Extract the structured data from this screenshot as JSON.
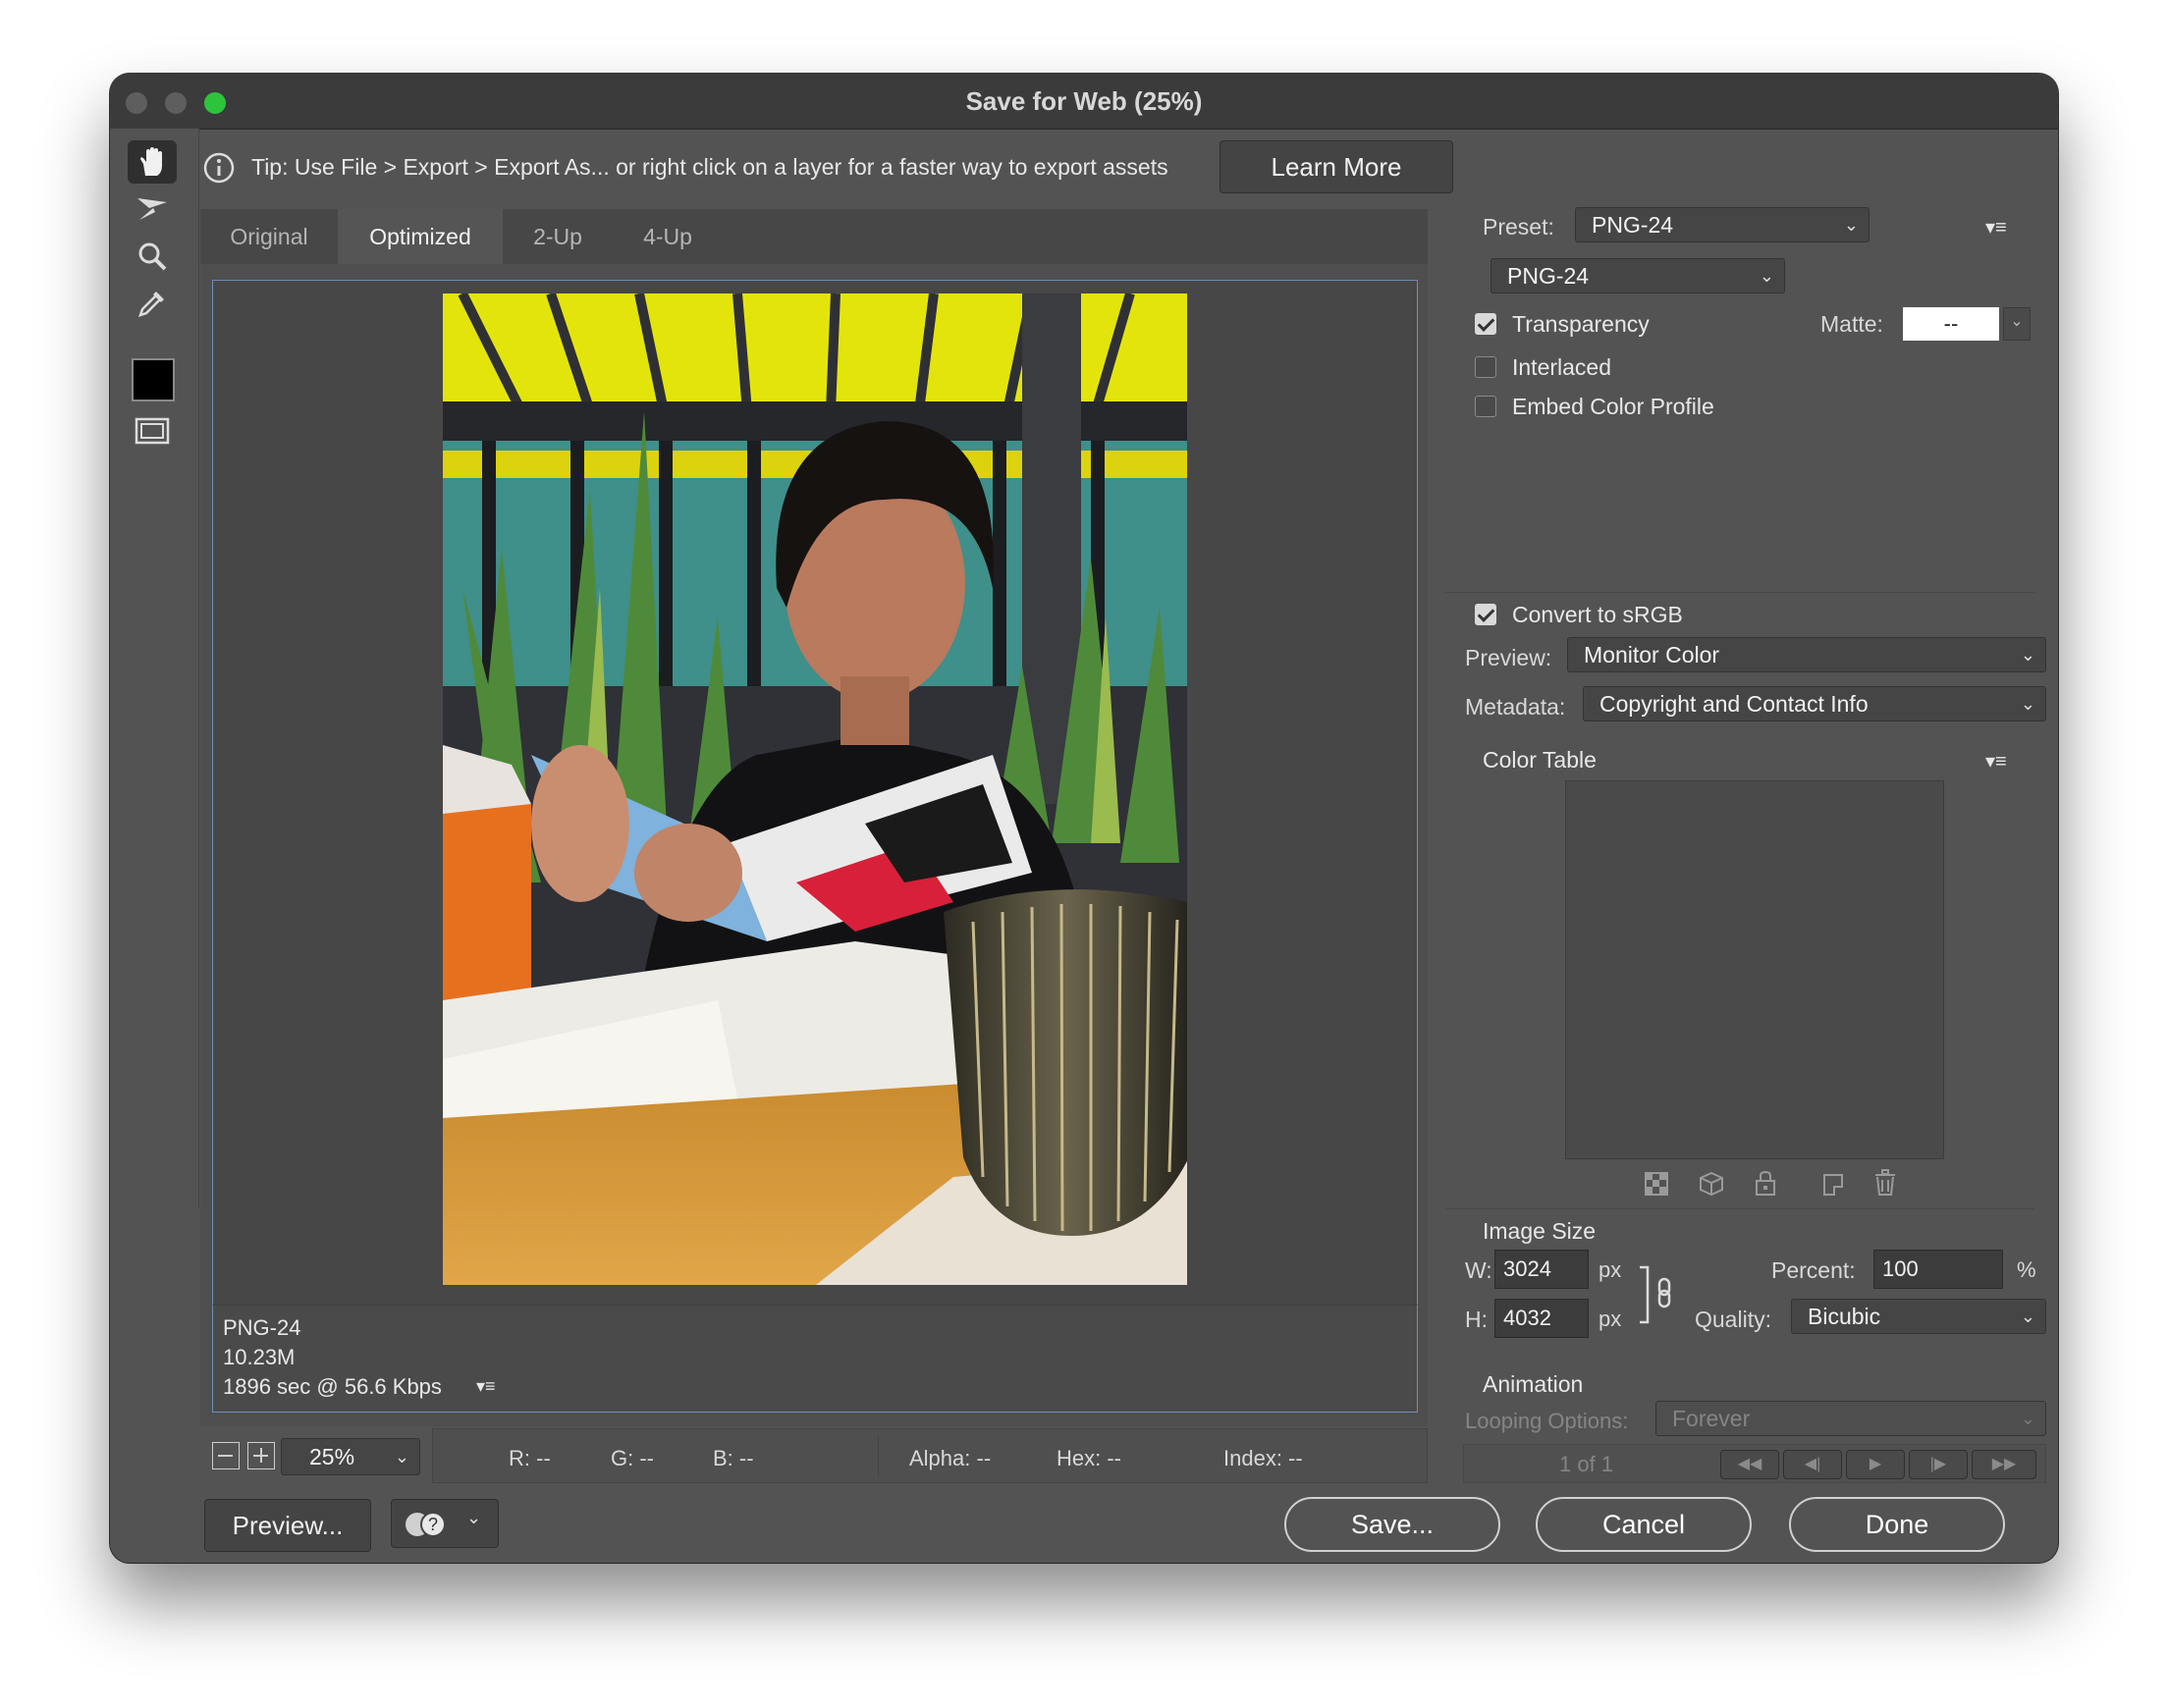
{
  "window": {
    "title": "Save for Web (25%)"
  },
  "tip": {
    "text": "Tip: Use File > Export > Export As...  or right click on a layer for a faster way to export assets",
    "learn_more": "Learn More"
  },
  "tools": [
    "hand-tool",
    "slice-select-tool",
    "zoom-tool",
    "eyedropper-tool",
    "eyedropper-color",
    "toggle-slices"
  ],
  "view_tabs": [
    "Original",
    "Optimized",
    "2-Up",
    "4-Up"
  ],
  "view_active": "Optimized",
  "image_info": {
    "format": "PNG-24",
    "size": "10.23M",
    "download": "1896 sec @ 56.6 Kbps"
  },
  "zoom": {
    "value": "25%"
  },
  "color_readout": {
    "r": "R: --",
    "g": "G: --",
    "b": "B: --",
    "alpha": "Alpha: --",
    "hex": "Hex: --",
    "index": "Index: --"
  },
  "settings": {
    "preset_label": "Preset:",
    "preset_value": "PNG-24",
    "format_value": "PNG-24",
    "transparency": "Transparency",
    "matte_label": "Matte:",
    "matte_value": "--",
    "interlaced": "Interlaced",
    "embed_profile": "Embed Color Profile",
    "convert_srgb": "Convert to sRGB",
    "preview_label": "Preview:",
    "preview_value": "Monitor Color",
    "metadata_label": "Metadata:",
    "metadata_value": "Copyright and Contact Info",
    "color_table": "Color Table"
  },
  "image_size": {
    "heading": "Image Size",
    "w_label": "W:",
    "w_value": "3024",
    "w_unit": "px",
    "h_label": "H:",
    "h_value": "4032",
    "h_unit": "px",
    "percent_label": "Percent:",
    "percent_value": "100",
    "percent_unit": "%",
    "quality_label": "Quality:",
    "quality_value": "Bicubic"
  },
  "animation": {
    "heading": "Animation",
    "looping_label": "Looping Options:",
    "looping_value": "Forever",
    "frame": "1 of 1"
  },
  "buttons": {
    "preview": "Preview...",
    "save": "Save...",
    "cancel": "Cancel",
    "done": "Done"
  },
  "colors": {
    "window_bg": "#535353",
    "titlebar": "#3b3b3b",
    "close": "#5e5e5e",
    "minimize": "#5e5e5e",
    "zoom": "#2dc43c",
    "focus_border": "#6f8fb5"
  }
}
